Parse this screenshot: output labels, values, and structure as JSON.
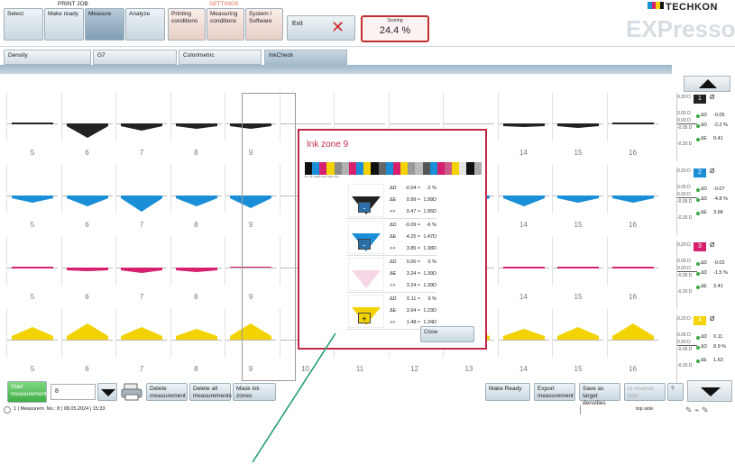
{
  "topbar": {
    "print_job_label": "PRINT JOB",
    "settings_label": "SETTINGS",
    "buttons": {
      "select": "Select",
      "make_ready": "Make ready",
      "measure": "Measure",
      "analyze": "Analyze",
      "printing_conditions": "Printing conditions",
      "measuring_conditions": "Measuring conditions",
      "system_software": "System / Software",
      "exit": "Exit"
    },
    "scoring_label": "Scoring",
    "scoring_value": "24.4 %",
    "brand": "TECHKON",
    "product": "EXPresso"
  },
  "tabs": [
    "Density",
    "G7",
    "Colorimetric",
    "InkCheck"
  ],
  "zones": [
    "5",
    "6",
    "7",
    "8",
    "9",
    "10",
    "11",
    "12",
    "13",
    "14",
    "15",
    "16"
  ],
  "side_panels": [
    {
      "num": "1",
      "color": "#222222",
      "delta_d": "-0.05",
      "delta_p": "-2.2 %",
      "delta_e": "0.41",
      "ticks": [
        "0.20 D",
        "0.05 D",
        "0.00 D",
        "-0.05 D",
        "-0.20 D"
      ]
    },
    {
      "num": "2",
      "color": "#1a8fd8",
      "delta_d": "-0.07",
      "delta_p": "-4.8 %",
      "delta_e": "3.68",
      "ticks": [
        "0.20 D",
        "0.05 D",
        "0.00 D",
        "-0.05 D",
        "-0.20 D"
      ]
    },
    {
      "num": "3",
      "color": "#d4206f",
      "delta_d": "-0.02",
      "delta_p": "-1.5 %",
      "delta_e": "3.41",
      "ticks": [
        "0.20 D",
        "0.05 D",
        "0.00 D",
        "-0.05 D",
        "-0.20 D"
      ]
    },
    {
      "num": "4",
      "color": "#f2d200",
      "delta_d": "0.11",
      "delta_p": "8.9 %",
      "delta_e": "1.63",
      "ticks": [
        "0.20 D",
        "0.05 D",
        "0.00 D",
        "-0.05 D",
        "-0.20 D"
      ]
    }
  ],
  "side_symbols": {
    "dd": "ΔD",
    "de": "ΔE",
    "empty": "Ø"
  },
  "popup": {
    "title": "Ink zone 9",
    "strip_labels": "B C M Y BAL 50 K 40% CM...",
    "close": "Close",
    "rows": [
      {
        "color": "#222222",
        "sign": "-",
        "lines": [
          [
            "ΔD",
            "-0.04 ≈",
            "-2 %"
          ],
          [
            "ΔE",
            "0.99 ≈",
            "1.99D"
          ],
          [
            ">>",
            "0.47 ≈",
            "1.95D"
          ]
        ]
      },
      {
        "color": "#1a8fd8",
        "sign": "-",
        "lines": [
          [
            "ΔD",
            "-0.09 ≈",
            "-6 %"
          ],
          [
            "ΔE",
            "4.25 ≈",
            "1.47D"
          ],
          [
            ">>",
            "3.85 ≈",
            "1.38D"
          ]
        ]
      },
      {
        "color": "#f5d6e4",
        "sign": "",
        "lines": [
          [
            "ΔD",
            "0.00 ≈",
            "0 %"
          ],
          [
            "ΔE",
            "3.24 ≈",
            "1.39D"
          ],
          [
            ">>",
            "3.24 ≈",
            "1.39D"
          ]
        ]
      },
      {
        "color": "#f2d200",
        "sign": "+",
        "lines": [
          [
            "ΔD",
            "0.11 ≈",
            "9 %"
          ],
          [
            "ΔE",
            "3.94 ≈",
            "1.23D"
          ],
          [
            ">>",
            "1.48 ≈",
            "1.34D"
          ]
        ]
      }
    ]
  },
  "bottombar": {
    "start": "Start measurement",
    "count": "8",
    "delete": "Delete measurement",
    "delete_all": "Delete all measurements",
    "mask": "Mask ink zones",
    "make_ready": "Make Ready",
    "export": "Export measurement",
    "save_target": "Save as target densities",
    "reverse": "to reverse side",
    "help": "?"
  },
  "status": {
    "text": "1 | Measurem. No.: 8 | 08.05.2024 | 15:33",
    "side": "top side"
  },
  "colors": {
    "black": "#222222",
    "cyan": "#1a8fd8",
    "magenta": "#d4206f",
    "yellow": "#f2d200",
    "accent": "#c12a46"
  }
}
